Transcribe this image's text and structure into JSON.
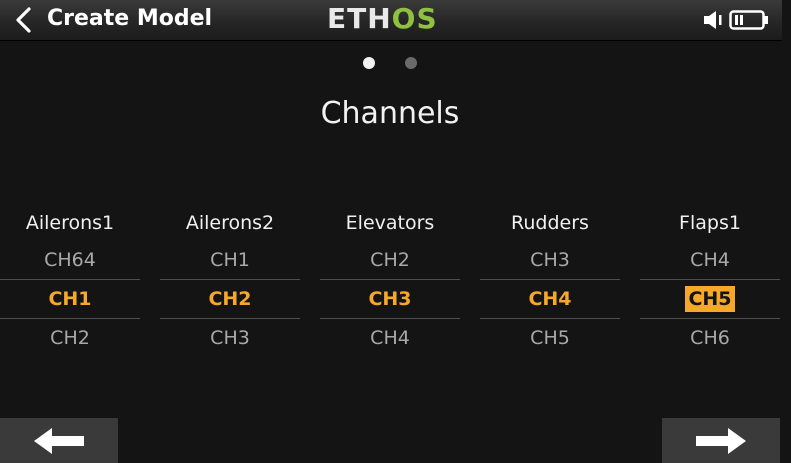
{
  "header": {
    "title": "Create Model",
    "logo_part1": "ETH",
    "logo_part2": "OS",
    "back_icon": "chevron-left-icon",
    "speaker_icon": "speaker-icon",
    "battery_icon": "battery-icon"
  },
  "pager": {
    "pages": 2,
    "active": 1
  },
  "page": {
    "heading": "Channels"
  },
  "channels": [
    {
      "label": "Ailerons1",
      "prev": "CH64",
      "current": "CH1",
      "next": "CH2"
    },
    {
      "label": "Ailerons2",
      "prev": "CH1",
      "current": "CH2",
      "next": "CH3"
    },
    {
      "label": "Elevators",
      "prev": "CH2",
      "current": "CH3",
      "next": "CH4"
    },
    {
      "label": "Rudders",
      "prev": "CH3",
      "current": "CH4",
      "next": "CH5"
    },
    {
      "label": "Flaps1",
      "prev": "CH4",
      "current": "CH5",
      "next": "CH6"
    }
  ],
  "focused_channel": "Flaps1",
  "nav": {
    "prev_icon": "arrow-left-icon",
    "next_icon": "arrow-right-icon"
  },
  "colors": {
    "accent": "#f5a82a",
    "logo_green": "#8ec13f",
    "background": "#141414",
    "header": "#2a2a2a",
    "button": "#3a3a3a"
  }
}
